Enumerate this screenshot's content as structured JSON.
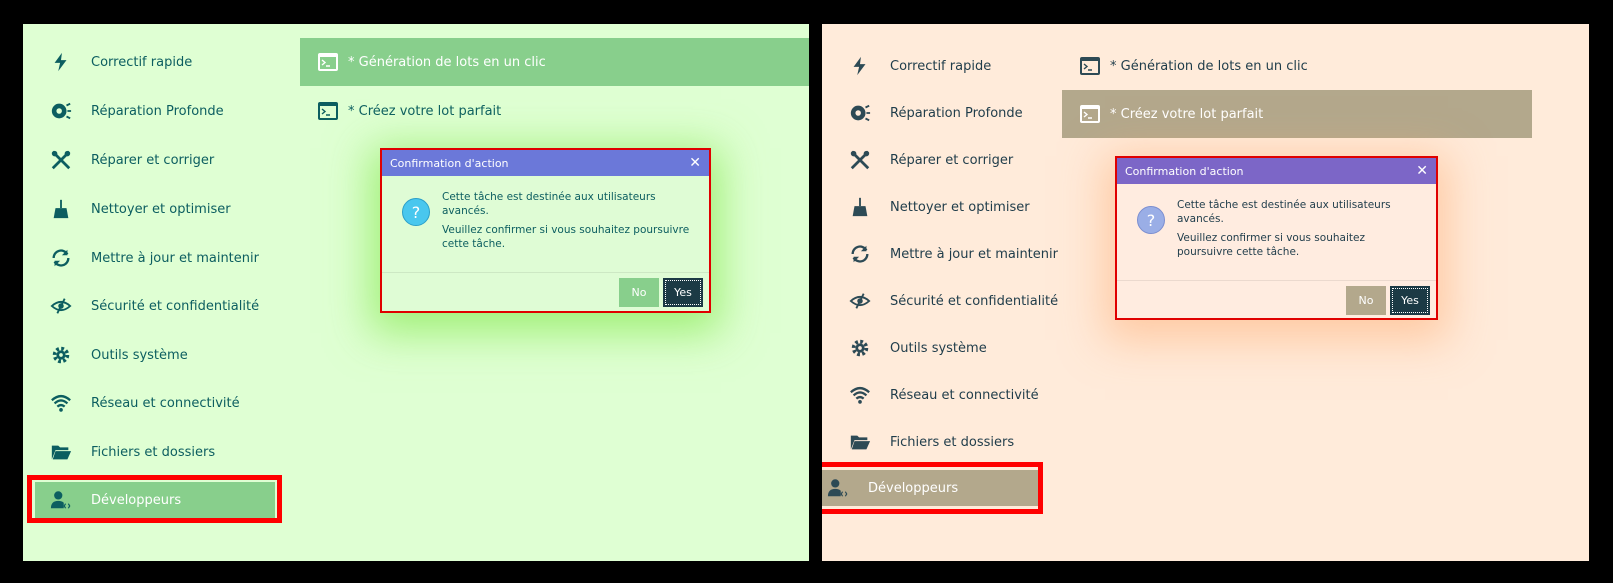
{
  "nav_items": [
    {
      "label": "Correctif rapide",
      "icon": "bolt-icon"
    },
    {
      "label": "Réparation Profonde",
      "icon": "deep-repair-icon"
    },
    {
      "label": "Réparer et corriger",
      "icon": "tools-icon"
    },
    {
      "label": "Nettoyer et optimiser",
      "icon": "broom-icon"
    },
    {
      "label": "Mettre à jour et maintenir",
      "icon": "refresh-icon"
    },
    {
      "label": "Sécurité et confidentialité",
      "icon": "privacy-eye-icon"
    },
    {
      "label": "Outils système",
      "icon": "gear-icon"
    },
    {
      "label": "Réseau et connectivité",
      "icon": "wifi-icon"
    },
    {
      "label": "Fichiers et dossiers",
      "icon": "folder-open-icon"
    },
    {
      "label": "Développeurs",
      "icon": "developer-user-icon"
    }
  ],
  "tasks": [
    {
      "label": "* Génération de lots en un clic",
      "icon": "terminal-icon"
    },
    {
      "label": "* Créez votre lot parfait",
      "icon": "terminal-icon"
    }
  ],
  "dialog": {
    "title": "Confirmation d'action",
    "close": "✕",
    "line1": "Cette tâche est destinée aux utilisateurs avancés.",
    "line2": "Veuillez confirmer si vous souhaitez poursuivre cette tâche.",
    "no_label": "No",
    "yes_label": "Yes",
    "icon": "question-icon",
    "icon_glyph": "?"
  },
  "themes": {
    "left": {
      "background": "#dfffd3",
      "accent": "#88cf8c",
      "title_bar": "#6b78d9",
      "text": "#0c5e60"
    },
    "right": {
      "background": "#ffebda",
      "accent": "#b3a88c",
      "title_bar": "#7c66c7",
      "text": "#1f3c4a"
    }
  }
}
